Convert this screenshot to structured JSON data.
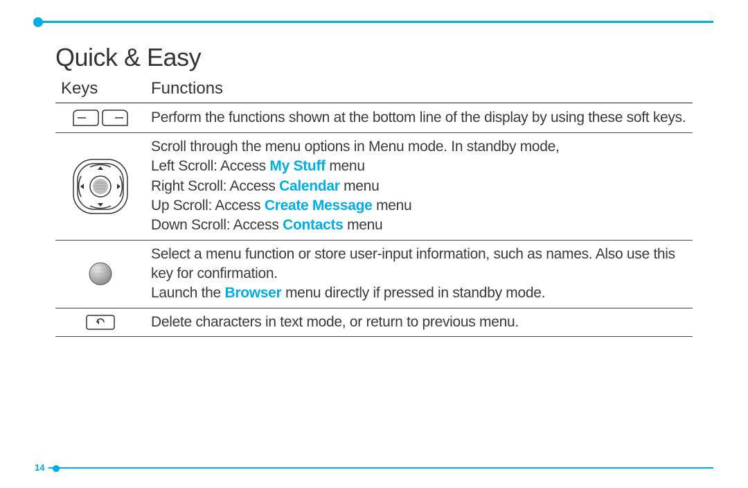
{
  "title": "Quick & Easy",
  "page_number": "14",
  "accent_color": "#00aee6",
  "table": {
    "headers": {
      "keys": "Keys",
      "functions": "Functions"
    },
    "rows": [
      {
        "icon": "soft-keys-icon",
        "text": "Perform the functions shown at the bottom line of the display by using these soft keys."
      },
      {
        "icon": "dpad-icon",
        "lines": {
          "intro": "Scroll through the menu options in Menu mode. In standby mode,",
          "left_pre": "Left Scroll: Access ",
          "left_link": "My Stuff",
          "left_post": " menu",
          "right_pre": "Right Scroll: Access ",
          "right_link": "Calendar",
          "right_post": " menu",
          "up_pre": "Up Scroll: Access ",
          "up_link": "Create Message",
          "up_post": " menu",
          "down_pre": "Down Scroll: Access ",
          "down_link": "Contacts",
          "down_post": " menu"
        }
      },
      {
        "icon": "center-ball-icon",
        "lines": {
          "a": "Select a menu function or store user-input information, such as names. Also use this key for confirmation.",
          "b_pre": "Launch the ",
          "b_link": "Browser",
          "b_post": " menu directly if pressed in standby mode."
        }
      },
      {
        "icon": "back-key-icon",
        "text": "Delete characters in text mode, or return to previous menu."
      }
    ]
  }
}
